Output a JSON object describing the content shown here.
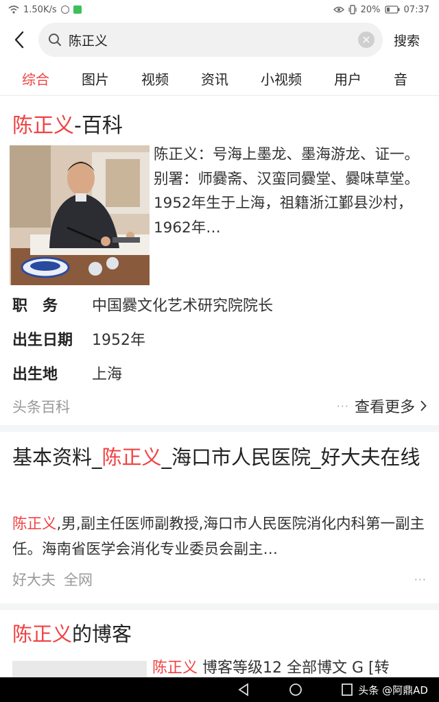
{
  "status": {
    "speed": "1.50K/s",
    "battery": "20%",
    "time": "07:37"
  },
  "search": {
    "query": "陈正义",
    "button": "搜索"
  },
  "tabs": [
    "综合",
    "图片",
    "视频",
    "资讯",
    "小视频",
    "用户",
    "音"
  ],
  "baike": {
    "title_name": "陈正义",
    "title_suffix": "-百科",
    "summary": "陈正义：号海上墨龙、墨海游龙、证一。别署：师爨斋、汉蛮同爨堂、爨味草堂。 1952年生于上海，祖籍浙江鄞县沙村，1962年…",
    "rows": [
      {
        "k": "职　务",
        "v": "中国爨文化艺术研究院院长"
      },
      {
        "k": "出生日期",
        "v": "1952年"
      },
      {
        "k": "出生地",
        "v": "上海"
      }
    ],
    "source": "头条百科",
    "more": "查看更多"
  },
  "result2": {
    "title_pre": "基本资料_",
    "title_name": "陈正义",
    "title_post": "_海口市人民医院_好大夫在线",
    "body_name": "陈正义",
    "body": ",男,副主任医师副教授,海口市人民医院消化内科第一副主任。海南省医学会消化专业委员会副主…",
    "sources": [
      "好大夫",
      "全网"
    ]
  },
  "result3": {
    "title_name": "陈正义",
    "title_post": "的博客",
    "snippet_name": "陈正义",
    "snippet": " 博客等级12 全部博文 G [转"
  },
  "watermark": "头条 @阿鼎AD",
  "colors": {
    "accent": "#f04142",
    "muted": "#999999"
  }
}
